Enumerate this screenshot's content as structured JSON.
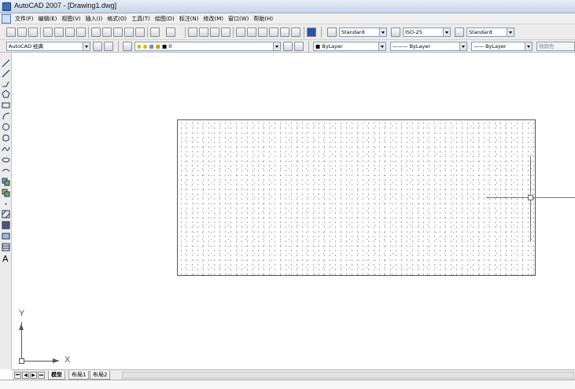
{
  "window": {
    "title": "AutoCAD 2007 - [Drawing1.dwg]"
  },
  "menu": [
    "文件(F)",
    "编辑(E)",
    "视图(V)",
    "插入(I)",
    "格式(O)",
    "工具(T)",
    "绘图(D)",
    "标注(N)",
    "修改(M)",
    "窗口(W)",
    "帮助(H)"
  ],
  "styles": {
    "text_style": "Standard",
    "dim_style": "ISO-25",
    "table_style": "Standard"
  },
  "workspace": "AutoCAD 经典",
  "layer": {
    "name": "0"
  },
  "properties": {
    "color": "ByLayer",
    "linetype": "ByLayer",
    "lineweight": "ByLayer",
    "plotstyle": "随颜色"
  },
  "ucs": {
    "x_label": "X",
    "y_label": "Y"
  },
  "layout_tabs": [
    "模型",
    "布局1",
    "布局2"
  ],
  "nav": {
    "first": "⏮",
    "prev": "◀",
    "next": "▶",
    "last": "⏭"
  }
}
